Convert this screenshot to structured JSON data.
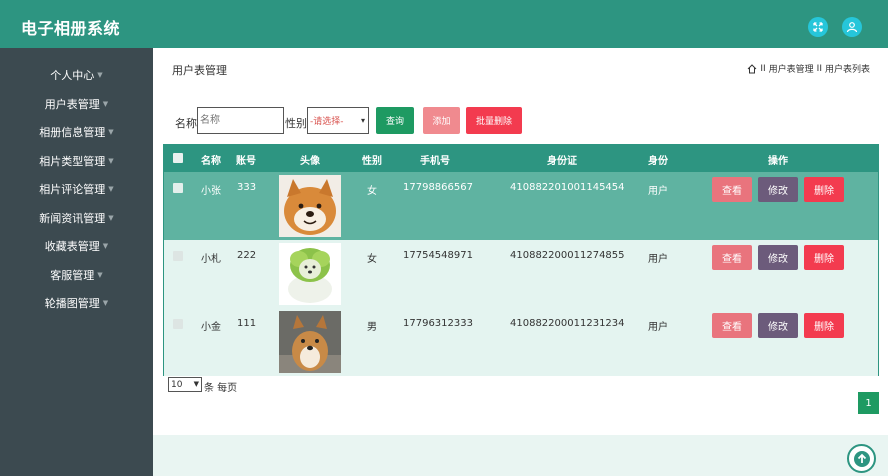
{
  "app": {
    "title": "电子相册系统"
  },
  "header_icons": [
    "fullscreen-icon",
    "user-icon"
  ],
  "sidebar": {
    "items": [
      {
        "label": "个人中心"
      },
      {
        "label": "用户表管理"
      },
      {
        "label": "相册信息管理"
      },
      {
        "label": "相片类型管理"
      },
      {
        "label": "相片评论管理"
      },
      {
        "label": "新闻资讯管理"
      },
      {
        "label": "收藏表管理"
      },
      {
        "label": "客服管理"
      },
      {
        "label": "轮播图管理"
      }
    ]
  },
  "page": {
    "title": "用户表管理",
    "breadcrumb": [
      "用户表管理",
      "用户表列表"
    ],
    "breadcrumb_sep": "II"
  },
  "search": {
    "name_label": "名称",
    "name_placeholder": "名称",
    "gender_label": "性别",
    "gender_selected": "-请选择-",
    "query_label": "查询",
    "add_label": "添加",
    "batch_delete_label": "批量删除"
  },
  "table": {
    "headers": [
      "名称",
      "账号",
      "头像",
      "性别",
      "手机号",
      "身份证",
      "身份",
      "操作"
    ],
    "rows": [
      {
        "name": "小张",
        "account": "333",
        "avatar": "shiba-smile",
        "gender": "女",
        "phone": "17798866567",
        "id_card": "410882201001145454",
        "role": "用户"
      },
      {
        "name": "小札",
        "account": "222",
        "avatar": "cabbage-dog",
        "gender": "女",
        "phone": "17754548971",
        "id_card": "410882200011274855",
        "role": "用户"
      },
      {
        "name": "小金",
        "account": "111",
        "avatar": "shiba-puppy",
        "gender": "男",
        "phone": "17796312333",
        "id_card": "410882200011231234",
        "role": "用户"
      }
    ],
    "actions": {
      "view": "查看",
      "edit": "修改",
      "delete": "删除"
    }
  },
  "pagination": {
    "page_size": "10",
    "per_page_text": "条 每页",
    "current_page": "1"
  },
  "colors": {
    "primary": "#2d9581",
    "sidebar": "#3c4a50",
    "row_highlight": "#5fb3a1",
    "row_light": "#e4f4f0",
    "view_btn": "#e9747d",
    "edit_btn": "#6c5b7b",
    "delete_btn": "#f33b4f"
  }
}
